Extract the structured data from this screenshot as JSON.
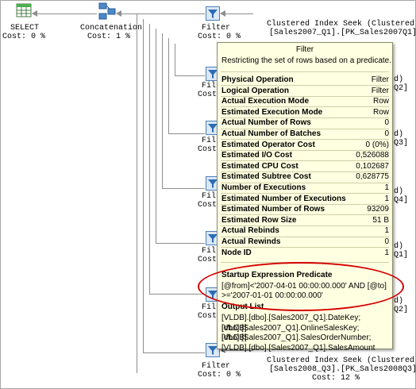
{
  "plan": {
    "select": {
      "label": "SELECT",
      "cost": "Cost: 0 %"
    },
    "concat": {
      "label": "Concatenation",
      "cost": "Cost: 1 %"
    },
    "filter_top": {
      "label": "Filter",
      "cost": "Cost: 0 %"
    },
    "filter_partial_label": "Filt",
    "filter_partial_cost": "Cost:",
    "filter_bottom": {
      "label": "Filter",
      "cost": "Cost: 0 %"
    },
    "seek_top": {
      "line1": "Clustered Index Seek (Clustered)",
      "line2": "[Sales2007_Q1].[PK_Sales2007Q1]"
    },
    "seek_bottom": {
      "line1": "Clustered Index Seek (Clustered)",
      "line2": "[Sales2008_Q3].[PK_Sales2008Q3]",
      "line3": "Cost: 12 %"
    },
    "right_partials": [
      "d)",
      "Q2]",
      "d)",
      "Q3]",
      "d)",
      "Q4]",
      "d)",
      "Q1]",
      "d)",
      "Q2]"
    ]
  },
  "tooltip": {
    "title": "Filter",
    "description": "Restricting the set of rows based on a predicate.",
    "properties": [
      {
        "key": "Physical Operation",
        "value": "Filter"
      },
      {
        "key": "Logical Operation",
        "value": "Filter"
      },
      {
        "key": "Actual Execution Mode",
        "value": "Row"
      },
      {
        "key": "Estimated Execution Mode",
        "value": "Row"
      },
      {
        "key": "Actual Number of Rows",
        "value": "0"
      },
      {
        "key": "Actual Number of Batches",
        "value": "0"
      },
      {
        "key": "Estimated Operator Cost",
        "value": "0 (0%)"
      },
      {
        "key": "Estimated I/O Cost",
        "value": "0,526088"
      },
      {
        "key": "Estimated CPU Cost",
        "value": "0,102687"
      },
      {
        "key": "Estimated Subtree Cost",
        "value": "0,628775"
      },
      {
        "key": "Number of Executions",
        "value": "1"
      },
      {
        "key": "Estimated Number of Executions",
        "value": "1"
      },
      {
        "key": "Estimated Number of Rows",
        "value": "93209"
      },
      {
        "key": "Estimated Row Size",
        "value": "51 B"
      },
      {
        "key": "Actual Rebinds",
        "value": "1"
      },
      {
        "key": "Actual Rewinds",
        "value": "0"
      },
      {
        "key": "Node ID",
        "value": "1"
      }
    ],
    "predicate_header": "Startup Expression Predicate",
    "predicate_line1": "[@from]<'2007-04-01 00:00:00.000' AND [@to]",
    "predicate_line2": ">='2007-01-01 00:00:00.000'",
    "output_header": "Output List",
    "output_lines": [
      "[VLDB].[dbo].[Sales2007_Q1].DateKey; [VLDB].",
      "[dbo].[Sales2007_Q1].OnlineSalesKey; [VLDB].",
      "[dbo].[Sales2007_Q1].SalesOrderNumber;",
      "[VLDB].[dbo].[Sales2007_Q1].SalesAmount"
    ]
  },
  "colors": {
    "highlight_oval": "#d40000",
    "tooltip_bg": "#ffffe1"
  }
}
